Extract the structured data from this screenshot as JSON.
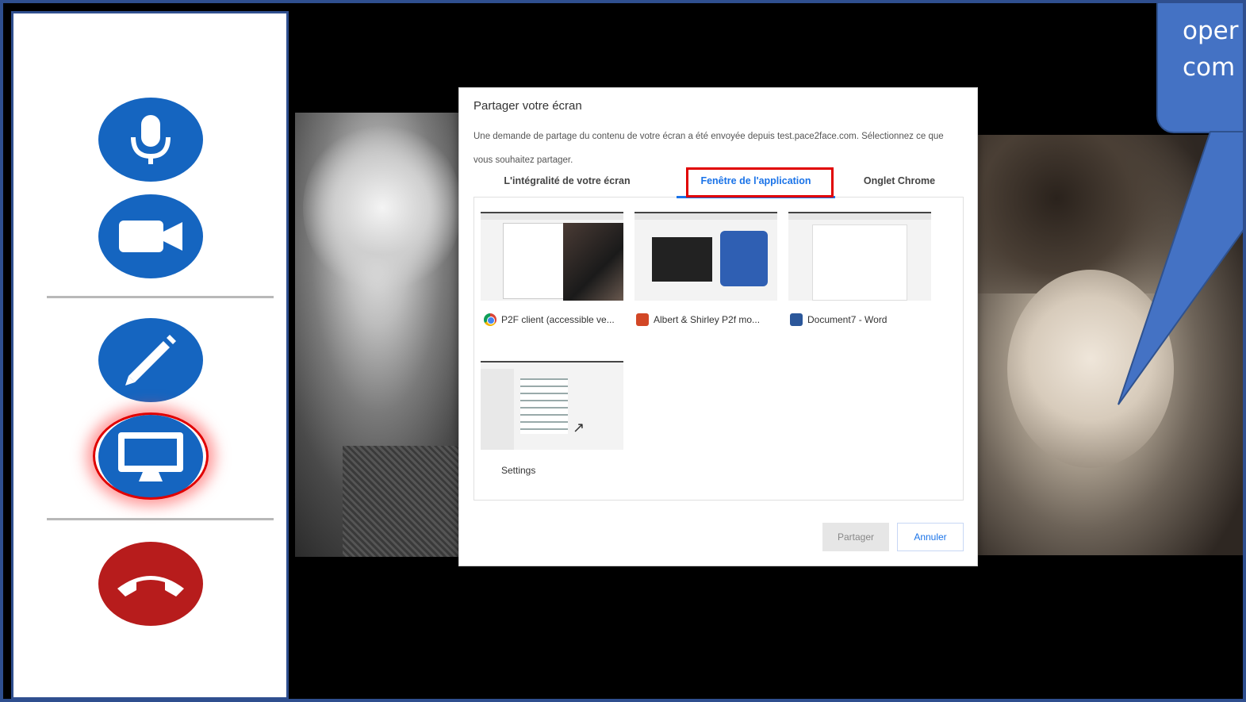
{
  "sidebar": {
    "mic_icon": "microphone-icon",
    "camera_icon": "video-camera-icon",
    "pen_icon": "pencil-icon",
    "screen_icon": "monitor-icon",
    "hangup_icon": "phone-hangup-icon"
  },
  "callout": {
    "text": "oper\ncom"
  },
  "dialog": {
    "title": "Partager votre écran",
    "description": "Une demande de partage du contenu de votre écran a été envoyée depuis test.pace2face.com. Sélectionnez ce que vous souhaitez partager.",
    "tabs": [
      {
        "label": "L'intégralité de votre écran"
      },
      {
        "label": "Fenêtre de l'application"
      },
      {
        "label": "Onglet Chrome"
      }
    ],
    "windows": [
      {
        "label": "P2F client (accessible ve...",
        "icon": "chrome-icon"
      },
      {
        "label": "Albert & Shirley P2f mo...",
        "icon": "powerpoint-icon"
      },
      {
        "label": "Document7 - Word",
        "icon": "word-icon"
      },
      {
        "label": "Settings",
        "icon": ""
      }
    ],
    "share_button": "Partager",
    "cancel_button": "Annuler"
  },
  "colors": {
    "frame_border": "#2f4f8f",
    "control_blue": "#1565c0",
    "hangup_red": "#b71c1c",
    "accent_blue": "#1a73e8",
    "highlight_red": "#e00000",
    "callout_blue": "#4472c4"
  }
}
